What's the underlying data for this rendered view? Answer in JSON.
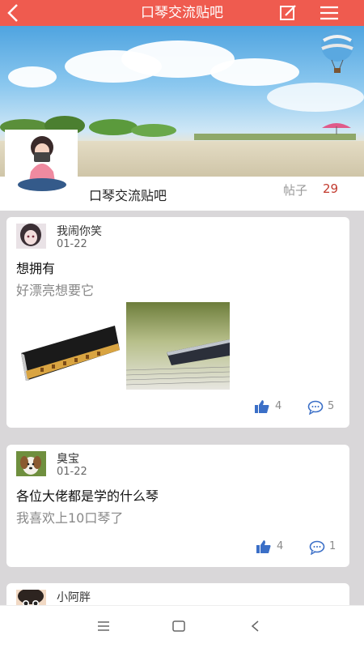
{
  "header": {
    "title": "口琴交流贴吧"
  },
  "forum": {
    "name": "口琴交流贴吧",
    "posts_label": "帖子",
    "posts_count": "29"
  },
  "posts": [
    {
      "user": "我闹你笑",
      "date": "01-22",
      "title": "想拥有",
      "body": "好漂亮想要它",
      "likes": "4",
      "comments": "5"
    },
    {
      "user": "臭宝",
      "date": "01-22",
      "title": "各位大佬都是学的什么琴",
      "body": "我喜欢上10口琴了",
      "likes": "4",
      "comments": "1"
    },
    {
      "user": "小阿胖"
    }
  ],
  "icons": {
    "header": [
      "back-arrow-icon",
      "edit-icon",
      "menu-icon"
    ],
    "post_stats": [
      "thumbs-up-icon",
      "comment-icon"
    ],
    "system_nav": [
      "recents-icon",
      "home-icon",
      "back-icon"
    ]
  },
  "colors": {
    "header_bg": "#ef5b4f",
    "count_red": "#c23a2e",
    "like_blue": "#3b6fc7"
  }
}
